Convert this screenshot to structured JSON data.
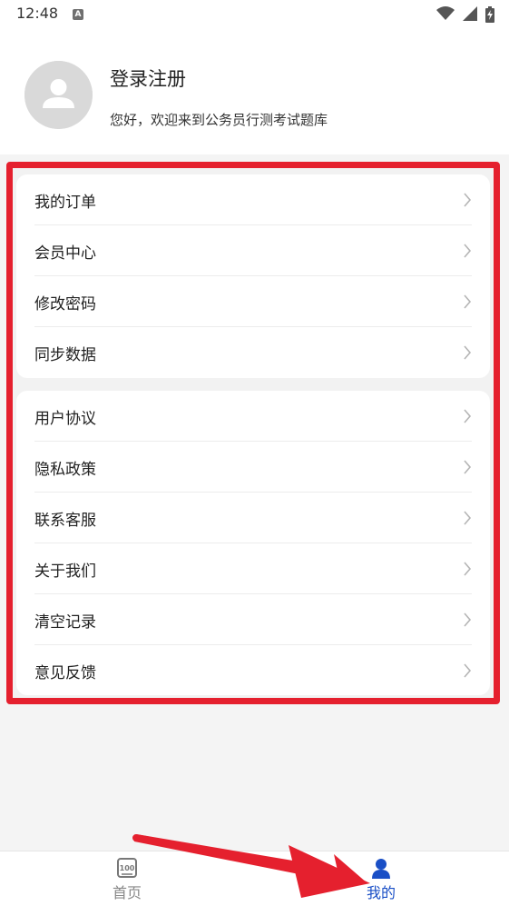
{
  "status_bar": {
    "time": "12:48",
    "badge": "A",
    "icons": [
      "wifi-icon",
      "signal-icon",
      "battery-charging-icon"
    ]
  },
  "profile": {
    "avatar_icon": "user-avatar-icon",
    "login_title": "登录注册",
    "welcome": "您好，欢迎来到公务员行测考试题库"
  },
  "menu": {
    "group1": [
      {
        "label": "我的订单"
      },
      {
        "label": "会员中心"
      },
      {
        "label": "修改密码"
      },
      {
        "label": "同步数据"
      }
    ],
    "group2": [
      {
        "label": "用户协议"
      },
      {
        "label": "隐私政策"
      },
      {
        "label": "联系客服"
      },
      {
        "label": "关于我们"
      },
      {
        "label": "清空记录"
      },
      {
        "label": "意见反馈"
      }
    ],
    "chevron_icon": "chevron-right-icon"
  },
  "bottom_nav": {
    "home_label": "首页",
    "mine_label": "我的",
    "active": "mine"
  },
  "colors": {
    "highlight": "#e5202e",
    "active_nav": "#1a4fc6",
    "inactive_nav": "#888888"
  }
}
